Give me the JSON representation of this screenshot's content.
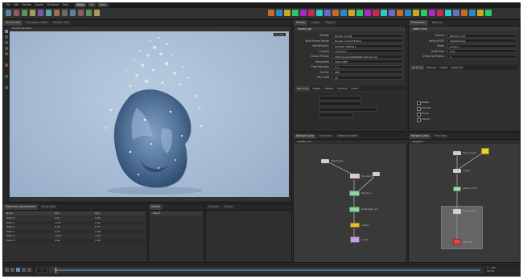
{
  "app": {
    "menu": [
      "File",
      "Edit",
      "Render",
      "Assets",
      "Windows",
      "Help"
    ],
    "desktop_tabs": [
      "Build",
      "FX",
      "Main"
    ],
    "shelf_colors": [
      "#5a7fa8",
      "#8f5a5a",
      "#5a8f6a",
      "#a89a5a",
      "#7a5aa8",
      "#5aa8a0",
      "#a86a5a",
      "#6a6a6a",
      "#5a7fa8",
      "#8f5a5a",
      "#5a8f6a",
      "#a89a5a"
    ],
    "shelf_right_colors": [
      "#c86a2a",
      "#2a8ac8",
      "#c8a82a",
      "#2ac86a",
      "#a82ac8",
      "#c82a4a",
      "#2ac8c8",
      "#6a6ac8",
      "#c86a2a",
      "#2a8ac8",
      "#c8a82a",
      "#2ac86a",
      "#a82ac8",
      "#c82a4a",
      "#2ac8c8",
      "#6a6ac8",
      "#c86a2a",
      "#2a8ac8",
      "#c8a82a",
      "#2ac86a",
      "#a82ac8",
      "#c82a4a",
      "#2ac8c8",
      "#6a6ac8",
      "#c86a2a",
      "#2a8ac8",
      "#c8a82a",
      "#2ac86a"
    ]
  },
  "viewport": {
    "tabs": [
      "Scene View",
      "Animation Editor",
      "Render View"
    ],
    "camera_label": "no cam",
    "display_mode": "Smooth Shaded",
    "bg_color": "#a7bcd4"
  },
  "render_params": {
    "tabs": [
      "Mantra",
      "Output",
      "Objects"
    ],
    "title": "mantra_ipr",
    "rows": [
      {
        "label": "Render",
        "value": "Render to Disk"
      },
      {
        "label": "Valid Frame Range",
        "value": "Render Current Frame"
      },
      {
        "label": "Start/End/Inc",
        "value": "$FSTART   $FEND   1"
      },
      {
        "label": "Camera",
        "value": "/obj/cam1"
      },
      {
        "label": "Output Picture",
        "value": "$HIP/render/$HIPNAME.$OS.$F4.exr"
      },
      {
        "label": "Resolution",
        "value": "1920   1080"
      },
      {
        "label": "Pixel Samples",
        "value": "3   3"
      },
      {
        "label": "Quality",
        "value": "PBR"
      },
      {
        "label": "Ray Limit",
        "value": "10"
      }
    ],
    "subtabs": [
      "Rendering",
      "Images",
      "Objects",
      "Scripting",
      "Driver"
    ]
  },
  "right_params": {
    "tabs": [
      "Parameters",
      "Take List"
    ],
    "title": "water_fluid",
    "rows": [
      {
        "label": "Source",
        "value": "Particle Fluid"
      },
      {
        "label": "Particle SOP",
        "value": "/obj/particles"
      },
      {
        "label": "Mode",
        "value": "Surface"
      },
      {
        "label": "Voxel Size",
        "value": "0.01"
      },
      {
        "label": "Influence Radius",
        "value": "2"
      }
    ],
    "subtabs": [
      "Surfacing",
      "Filtering",
      "Output",
      "Advanced"
    ],
    "checks": [
      "Dilate",
      "Smooth",
      "Erode",
      "Clamp"
    ]
  },
  "node_graph_1": {
    "tabs": [
      "Network View",
      "Tree View",
      "Material Palette"
    ],
    "path": "/obj/flip_sim",
    "nodes": [
      "import_geo",
      "flip_source",
      "flipsolver",
      "whitewater_src",
      "output",
      "render"
    ]
  },
  "node_graph_2": {
    "tabs": [
      "Network View",
      "Tree View"
    ],
    "path": "/obj/geo1",
    "nodes": [
      "fluid_import",
      "merge",
      "particle_fluid",
      "volume_vop",
      "null_OUT"
    ]
  },
  "spreadsheet": {
    "tabs": [
      "Geometry Spreadsheet",
      "Scene Data"
    ],
    "columns": [
      "Node",
      "P[x]",
      "P[y]"
    ],
    "rows": [
      [
        "Point 0",
        "0.12",
        "1.84"
      ],
      [
        "Point 1",
        "-0.07",
        "1.91"
      ],
      [
        "Point 2",
        "0.31",
        "1.77"
      ],
      [
        "Point 3",
        "0.22",
        "1.66"
      ],
      [
        "Point 4",
        "-0.15",
        "1.72"
      ],
      [
        "Point 5",
        "0.05",
        "1.59"
      ]
    ]
  },
  "log_panel": {
    "tabs": [
      "Details",
      "Console",
      "Python"
    ],
    "col_header": "Result"
  },
  "timeline": {
    "frame": "1",
    "start": "1",
    "end": "240",
    "fps_label": "24 fps"
  }
}
